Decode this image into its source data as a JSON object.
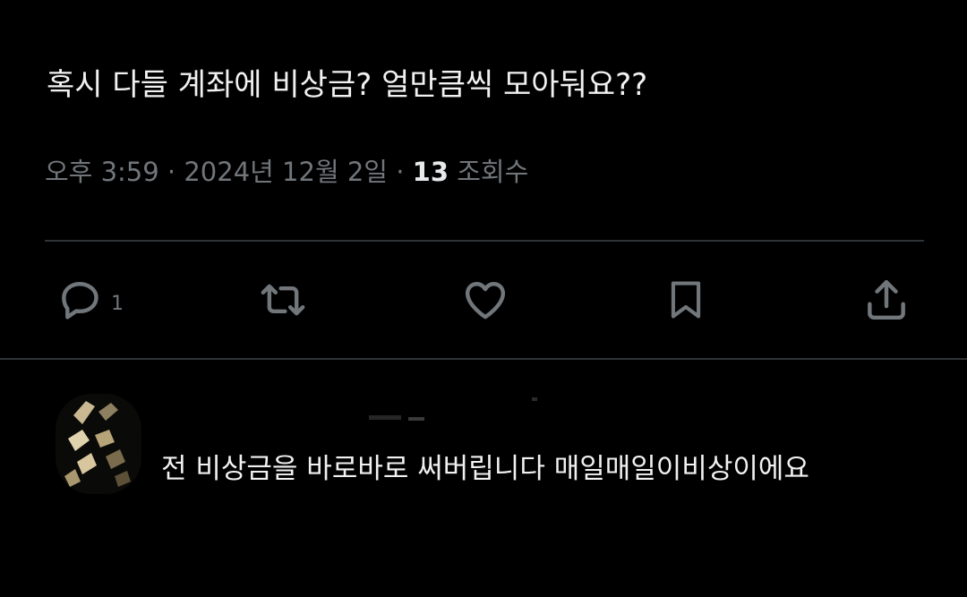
{
  "tweet": {
    "text": "혹시 다들 계좌에 비상금? 얼만큼씩 모아둬요??",
    "meta_prefix": "오후 3:59 · 2024년 12월 2일 · ",
    "view_count": "13",
    "view_label": " 조회수"
  },
  "actions": {
    "reply_icon": "comment-icon",
    "reply_count": "1",
    "retweet_icon": "retweet-icon",
    "like_icon": "heart-icon",
    "bookmark_icon": "bookmark-icon",
    "share_icon": "share-icon"
  },
  "reply": {
    "text": "전 비상금을 바로바로 써버립니다 매일매일이비상이에요"
  },
  "colors": {
    "background": "#000000",
    "text": "#e7e9ea",
    "muted": "#71767b",
    "divider": "#2f3336"
  }
}
